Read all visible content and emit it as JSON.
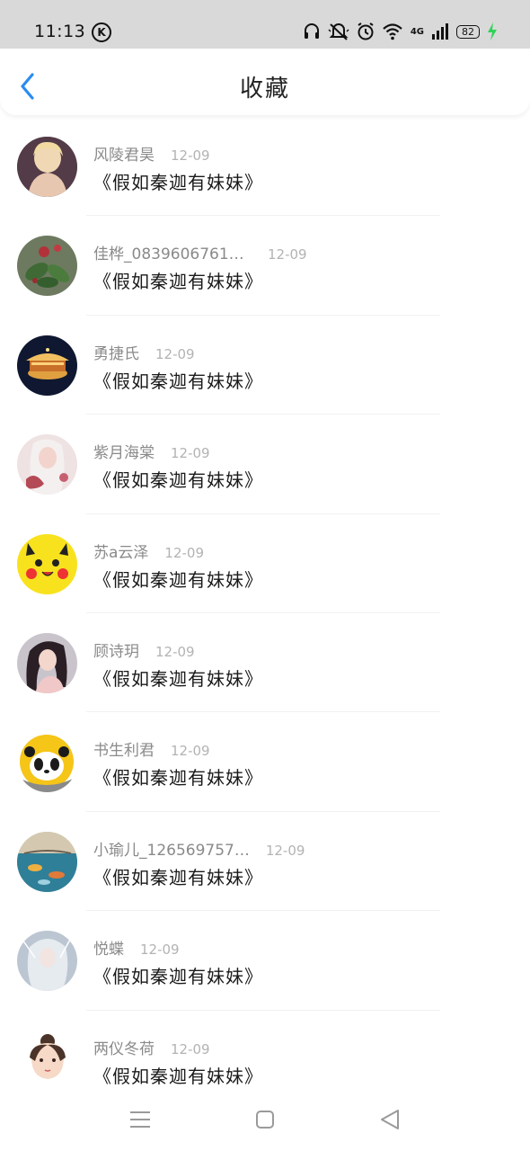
{
  "status_bar": {
    "time": "11:13",
    "k_label": "K",
    "network": "4G",
    "battery": "82",
    "icons": [
      "k-circle-icon",
      "headphones-icon",
      "mute-icon",
      "alarm-icon",
      "wifi-icon",
      "cell-signal-icon",
      "battery-icon",
      "charging-icon"
    ]
  },
  "header": {
    "title": "收藏",
    "back_icon": "chevron-left-icon",
    "accent_color": "#2a8cf0"
  },
  "items": [
    {
      "user": "风陵君昊",
      "date": "12-09",
      "title": "《假如秦迦有妹妹》"
    },
    {
      "user": "佳桦_08396067610…",
      "date": "12-09",
      "title": "《假如秦迦有妹妹》"
    },
    {
      "user": "勇捷氏",
      "date": "12-09",
      "title": "《假如秦迦有妹妹》"
    },
    {
      "user": "紫月海棠",
      "date": "12-09",
      "title": "《假如秦迦有妹妹》"
    },
    {
      "user": "苏a云泽",
      "date": "12-09",
      "title": "《假如秦迦有妹妹》"
    },
    {
      "user": "顾诗玥",
      "date": "12-09",
      "title": "《假如秦迦有妹妹》"
    },
    {
      "user": "书生利君",
      "date": "12-09",
      "title": "《假如秦迦有妹妹》"
    },
    {
      "user": "小瑜儿_126569757…",
      "date": "12-09",
      "title": "《假如秦迦有妹妹》"
    },
    {
      "user": "悦蝶",
      "date": "12-09",
      "title": "《假如秦迦有妹妹》"
    },
    {
      "user": "两仪冬荷",
      "date": "12-09",
      "title": "《假如秦迦有妹妹》"
    }
  ],
  "nav_bar": {
    "icons": [
      "menu-icon",
      "home-square-icon",
      "back-triangle-icon"
    ]
  }
}
